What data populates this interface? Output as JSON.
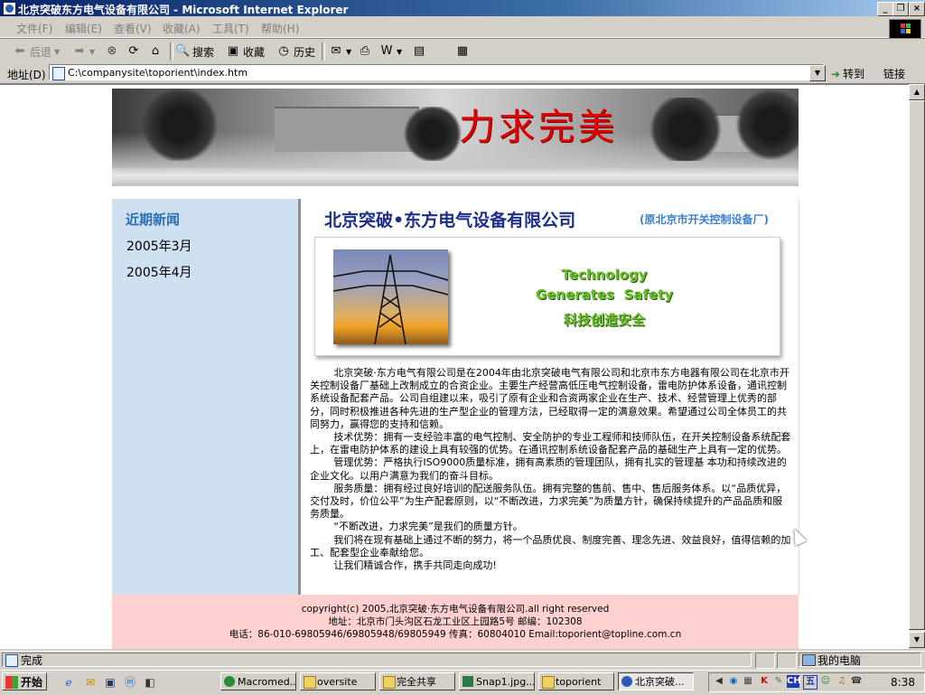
{
  "window": {
    "title": "北京突破东方电气设备有限公司 - Microsoft Internet Explorer",
    "minimize": "_",
    "restore": "❐",
    "close": "×"
  },
  "menu": [
    "文件(F)",
    "编辑(E)",
    "查看(V)",
    "收藏(A)",
    "工具(T)",
    "帮助(H)"
  ],
  "toolbar": {
    "back": "后退",
    "forward": "",
    "search": "搜索",
    "favorites": "收藏",
    "history": "历史"
  },
  "address": {
    "label": "地址(D)",
    "url": "C:\\companysite\\toporient\\index.htm",
    "go": "转到",
    "links": "链接"
  },
  "page": {
    "banner_text": "力求完美",
    "sidebar": {
      "title": "近期新闻",
      "items": [
        "2005年3月",
        "2005年4月"
      ]
    },
    "company_name": "北京突破•东方电气设备有限公司",
    "company_sub": "(原北京市开关控制设备厂)",
    "slogan": {
      "en1": "Technology",
      "en2": "Generates  Safety",
      "cn": "科技创造安全"
    },
    "paragraphs": [
      "北京突破·东方电气有限公司是在2004年由北京突破电气有限公司和北京市东方电器有限公司在北京市开关控制设备厂基础上改制成立的合资企业。主要生产经营高低压电气控制设备，雷电防护体系设备，通讯控制系统设备配套产品。公司自组建以来，吸引了原有企业和合资两家企业在生产、技术、经营管理上优秀的部分，同时积极推进各种先进的生产型企业的管理方法，已经取得一定的满意效果。希望通过公司全体员工的共同努力，赢得您的支持和信赖。",
      "技术优势：拥有一支经验丰富的电气控制、安全防护的专业工程师和技师队伍，在开关控制设备系统配套上，在雷电防护体系的建设上具有较强的优势。在通讯控制系统设备配套产品的基础生产上具有一定的优势。",
      "管理优势：严格执行ISO9000质量标准，拥有高素质的管理团队，拥有扎实的管理基 本功和持续改进的企业文化。以用户满意为我们的奋斗目标。",
      "服务质量：拥有经过良好培训的配送服务队伍。拥有完整的售前、售中、售后服务体系。以“品质优异，交付及时，价位公平”为生产配套原则，以“不断改进，力求完美”为质量方针，确保持续提升的产品品质和服务质量。",
      "“不断改进，力求完美”是我们的质量方针。",
      "我们将在现有基础上通过不断的努力，将一个品质优良、制度完善、理念先进、效益良好，值得信赖的加工、配套型企业奉献给您。",
      "让我们精诚合作，携手共同走向成功!"
    ],
    "footer": {
      "copyright": "copyright(c) 2005,北京突破·东方电气设备有限公司.all right reserved",
      "address": "地址：北京市门头沟区石龙工业区上园路5号 邮编：102308",
      "contact": "电话：86-010-69805946/69805948/69805949 传真：60804010 Email:toporient@topline.com.cn"
    }
  },
  "status": {
    "text": "完成",
    "zone": "我的电脑"
  },
  "taskbar": {
    "start": "开始",
    "tasks": [
      "Macromed...",
      "oversite",
      "完全共享",
      "Snap1.jpg...",
      "toporient",
      "北京突破..."
    ],
    "active_index": 5,
    "tray_lang": "CH",
    "tray_ime": "五",
    "clock": "8:38"
  }
}
